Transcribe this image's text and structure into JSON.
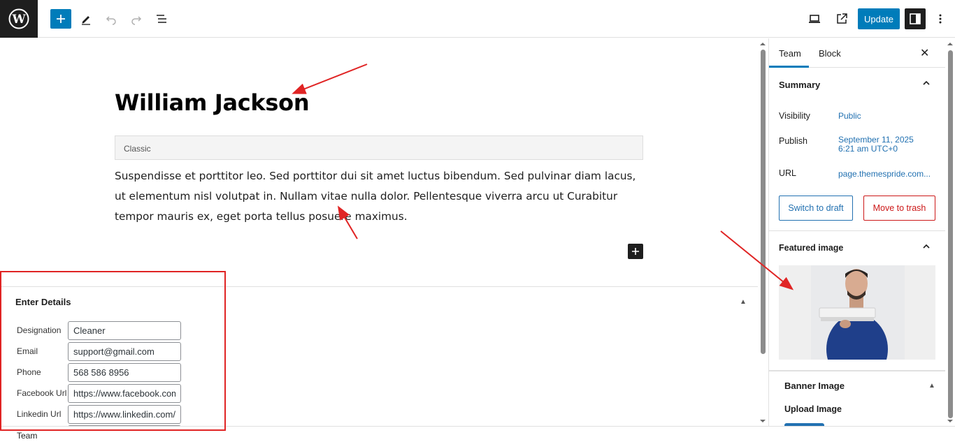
{
  "toolbar": {
    "update_label": "Update"
  },
  "post": {
    "title": "William Jackson",
    "block_type_label": "Classic",
    "content": "Suspendisse et porttitor leo. Sed porttitor dui sit amet luctus bibendum. Sed pulvinar diam lacus, ut elementum nisl volutpat in. Nullam vitae nulla dolor. Pellentesque viverra arcu ut Curabitur tempor mauris ex, eget porta tellus posuere maximus."
  },
  "meta_box": {
    "title": "Enter Details",
    "fields": [
      {
        "label": "Designation",
        "value": "Cleaner"
      },
      {
        "label": "Email",
        "value": "support@gmail.com"
      },
      {
        "label": "Phone",
        "value": "568 586 8956"
      },
      {
        "label": "Facebook Url",
        "value": "https://www.facebook.com/"
      },
      {
        "label": "Linkedin Url",
        "value": "https://www.linkedin.com/"
      }
    ]
  },
  "footer": {
    "breadcrumb": "Team"
  },
  "sidebar": {
    "tabs": [
      "Team",
      "Block"
    ],
    "summary": {
      "title": "Summary",
      "visibility_label": "Visibility",
      "visibility_value": "Public",
      "publish_label": "Publish",
      "publish_value_line1": "September 11, 2025",
      "publish_value_line2": "6:21 am UTC+0",
      "url_label": "URL",
      "url_value": "page.themespride.com...",
      "switch_draft_label": "Switch to draft",
      "move_trash_label": "Move to trash"
    },
    "featured_image": {
      "title": "Featured image"
    },
    "banner": {
      "title": "Banner Image",
      "upload_label": "Upload Image"
    }
  },
  "colors": {
    "accent": "#007cba",
    "danger": "#cc1818",
    "annotation": "#e02424"
  }
}
